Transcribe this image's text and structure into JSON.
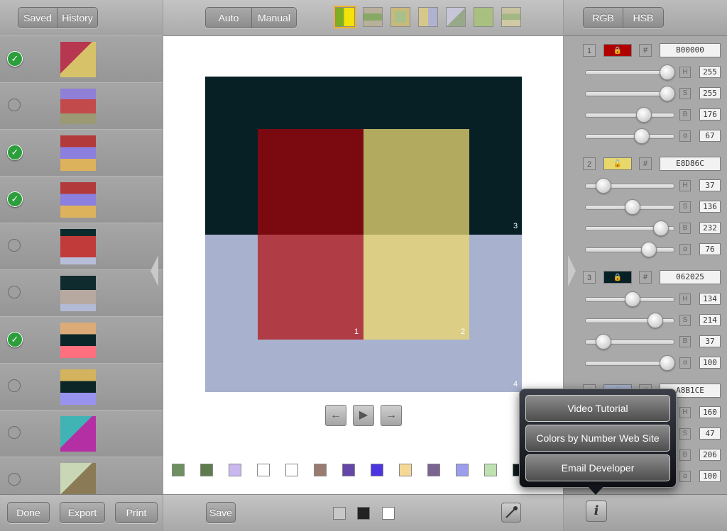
{
  "left_panel": {
    "tabs": [
      "Saved",
      "History"
    ],
    "rows": [
      {
        "checked": true,
        "thumb": "cube"
      },
      {
        "checked": false,
        "thumb": "nested"
      },
      {
        "checked": true,
        "thumb": "bands"
      },
      {
        "checked": true,
        "thumb": "bands2"
      },
      {
        "checked": false,
        "thumb": "quad"
      },
      {
        "checked": false,
        "thumb": "soft"
      },
      {
        "checked": true,
        "thumb": "stripes"
      },
      {
        "checked": false,
        "thumb": "stripes2"
      },
      {
        "checked": false,
        "thumb": "cube2"
      },
      {
        "checked": false,
        "thumb": "cube3"
      }
    ],
    "buttons": {
      "done": "Done",
      "export": "Export",
      "print": "Print"
    }
  },
  "center": {
    "mode_tabs": [
      "Auto",
      "Manual"
    ],
    "layout_icons": [
      "layout-split-icon",
      "layout-cross-icon",
      "layout-frame-icon",
      "layout-quads-icon",
      "layout-3d-icon",
      "layout-pattern-icon",
      "layout-stack-icon"
    ],
    "composition": {
      "color1": "#B00000",
      "color2": "#E8D86C",
      "color3": "#062025",
      "color4": "#A8B1CE",
      "labels": [
        "1",
        "2",
        "3",
        "4"
      ]
    },
    "swatches": [
      "#6e8f5f",
      "#5f7c4e",
      "#c9b8ef",
      "#ffffff",
      "#ffffff",
      "#9a7b70",
      "#6645a8",
      "#4a35e0",
      "#f6d896",
      "#7b6590",
      "#9b9ded",
      "#bfe0b0",
      "#0e1a1e"
    ],
    "save_label": "Save",
    "bg_options": [
      "#c8c8c8",
      "#222222",
      "#ffffff"
    ]
  },
  "right_panel": {
    "tabs": [
      "RGB",
      "HSB"
    ],
    "colors": [
      {
        "index": "1",
        "hex": "B00000",
        "swatch": "#B00000",
        "locked": true,
        "channels": [
          {
            "label": "H",
            "value": "255",
            "pos": 1.0
          },
          {
            "label": "S",
            "value": "255",
            "pos": 1.0
          },
          {
            "label": "B",
            "value": "176",
            "pos": 0.69
          },
          {
            "label": "α",
            "value": "67",
            "pos": 0.66
          }
        ]
      },
      {
        "index": "2",
        "hex": "E8D86C",
        "swatch": "#E8D86C",
        "locked": false,
        "channels": [
          {
            "label": "H",
            "value": "37",
            "pos": 0.14
          },
          {
            "label": "S",
            "value": "136",
            "pos": 0.53
          },
          {
            "label": "B",
            "value": "232",
            "pos": 0.91
          },
          {
            "label": "α",
            "value": "76",
            "pos": 0.75
          }
        ]
      },
      {
        "index": "3",
        "hex": "062025",
        "swatch": "#062025",
        "locked": true,
        "channels": [
          {
            "label": "H",
            "value": "134",
            "pos": 0.53
          },
          {
            "label": "S",
            "value": "214",
            "pos": 0.84
          },
          {
            "label": "B",
            "value": "37",
            "pos": 0.14
          },
          {
            "label": "α",
            "value": "100",
            "pos": 1.0
          }
        ]
      },
      {
        "index": "4",
        "hex": "A8B1CE",
        "swatch": "#A8B1CE",
        "locked": false,
        "channels": [
          {
            "label": "H",
            "value": "160",
            "pos": 0.63
          },
          {
            "label": "S",
            "value": "47",
            "pos": 0.18
          },
          {
            "label": "B",
            "value": "206",
            "pos": 0.81
          },
          {
            "label": "α",
            "value": "100",
            "pos": 1.0
          }
        ]
      }
    ]
  },
  "popover": {
    "items": [
      "Video Tutorial",
      "Colors by Number Web Site",
      "Email Developer"
    ]
  }
}
